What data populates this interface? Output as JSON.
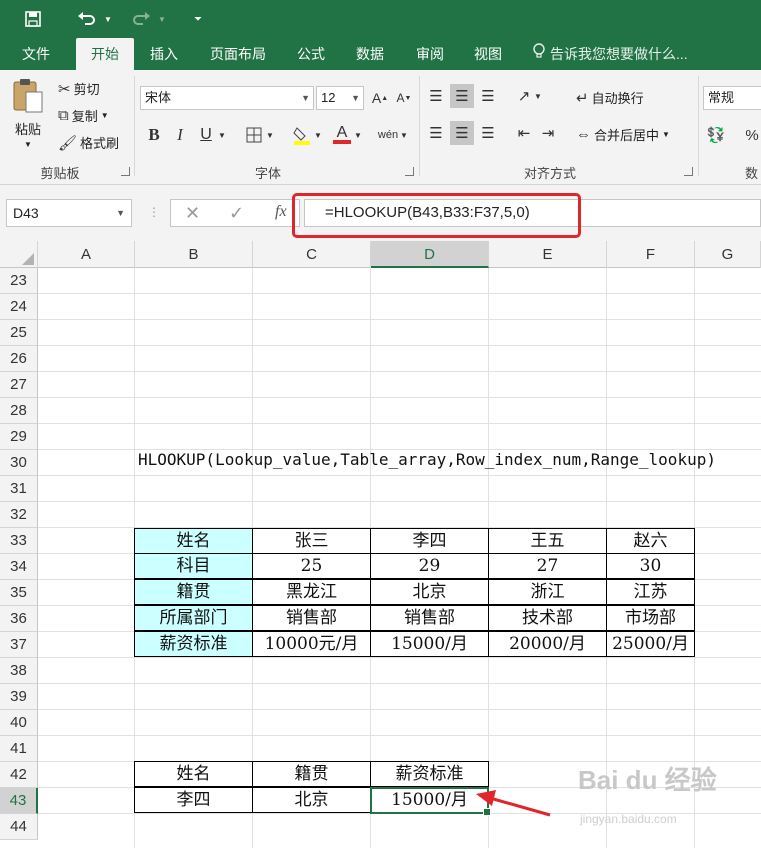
{
  "quick_access": {
    "save_icon": "save-icon",
    "undo_icon": "undo-icon",
    "redo_icon": "redo-icon",
    "customize_icon": "dropdown-icon"
  },
  "tabs": [
    {
      "label": "文件"
    },
    {
      "label": "开始",
      "active": true
    },
    {
      "label": "插入"
    },
    {
      "label": "页面布局"
    },
    {
      "label": "公式"
    },
    {
      "label": "数据"
    },
    {
      "label": "审阅"
    },
    {
      "label": "视图"
    }
  ],
  "tell_me": "告诉我您想要做什么...",
  "ribbon": {
    "clipboard": {
      "paste": "粘贴",
      "cut": "剪切",
      "copy": "复制",
      "format_painter": "格式刷",
      "label": "剪贴板"
    },
    "font": {
      "name": "宋体",
      "size": "12",
      "bold": "B",
      "italic": "I",
      "underline": "U",
      "label": "字体",
      "font_color": "#e0262b",
      "fill_color": "#ffff00"
    },
    "alignment": {
      "wrap_text": "自动换行",
      "merge_center": "合并后居中",
      "label": "对齐方式"
    },
    "number": {
      "format": "常规",
      "label_partial": "数"
    }
  },
  "formula_bar": {
    "name_box": "D43",
    "fx": "fx",
    "formula": "=HLOOKUP(B43,B33:F37,5,0)"
  },
  "columns": [
    "A",
    "B",
    "C",
    "D",
    "E",
    "F",
    "G"
  ],
  "rows": [
    "23",
    "24",
    "25",
    "26",
    "27",
    "28",
    "29",
    "30",
    "31",
    "32",
    "33",
    "34",
    "35",
    "36",
    "37",
    "38",
    "39",
    "40",
    "41",
    "42",
    "43",
    "44"
  ],
  "row30_text": "HLOOKUP(Lookup_value,Table_array,Row_index_num,Range_lookup)",
  "table": {
    "rows": [
      [
        "姓名",
        "张三",
        "李四",
        "王五",
        "赵六"
      ],
      [
        "科目",
        "25",
        "29",
        "27",
        "30"
      ],
      [
        "籍贯",
        "黑龙江",
        "北京",
        "浙江",
        "江苏"
      ],
      [
        "所属部门",
        "销售部",
        "销售部",
        "技术部",
        "市场部"
      ],
      [
        "薪资标准",
        "10000元/月",
        "15000/月",
        "20000/月",
        "25000/月"
      ]
    ]
  },
  "lookup": {
    "headers": [
      "姓名",
      "籍贯",
      "薪资标准"
    ],
    "values": [
      "李四",
      "北京",
      "15000/月"
    ]
  },
  "watermark": {
    "text": "Bai du 经验",
    "sub": "jingyan.baidu.com"
  },
  "colors": {
    "excel_green": "#217346",
    "highlight_cyan": "#ccffff",
    "annotation_red": "#e0262b"
  }
}
